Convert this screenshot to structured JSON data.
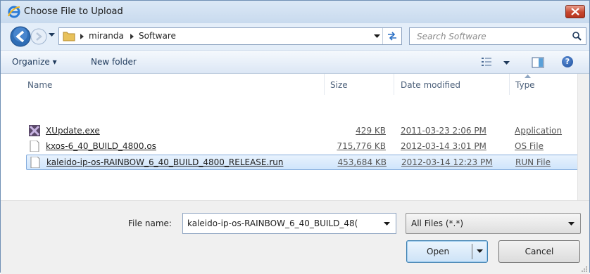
{
  "window": {
    "title": "Choose File to Upload"
  },
  "address_bar": {
    "crumbs": [
      "miranda",
      "Software"
    ]
  },
  "search": {
    "placeholder": "Search Software"
  },
  "toolbar": {
    "organize_label": "Organize ▾",
    "new_folder_label": "New folder"
  },
  "columns": {
    "name": "Name",
    "size": "Size",
    "date": "Date modified",
    "type": "Type"
  },
  "files": [
    {
      "name": "XUpdate.exe",
      "size": "429 KB",
      "date": "2011-03-23 2:06 PM",
      "type": "Application",
      "icon": "xupdate-app-icon"
    },
    {
      "name": "kxos-6_40_BUILD_4800.os",
      "size": "715,776 KB",
      "date": "2012-03-14 3:01 PM",
      "type": "OS File",
      "icon": "blank-file-icon"
    },
    {
      "name": "kaleido-ip-os-RAINBOW_6_40_BUILD_4800_RELEASE.run",
      "size": "453,684 KB",
      "date": "2012-03-14 12:23 PM",
      "type": "RUN File",
      "icon": "blank-file-icon",
      "selected": true
    }
  ],
  "footer": {
    "file_name_label": "File name:",
    "file_name_value": "kaleido-ip-os-RAINBOW_6_40_BUILD_48(",
    "file_type_value": "All Files (*.*)",
    "open_label": "Open",
    "cancel_label": "Cancel"
  },
  "colors": {
    "accent": "#3c7fb1",
    "selection": "#cfe5fc",
    "close": "#c6462e"
  }
}
